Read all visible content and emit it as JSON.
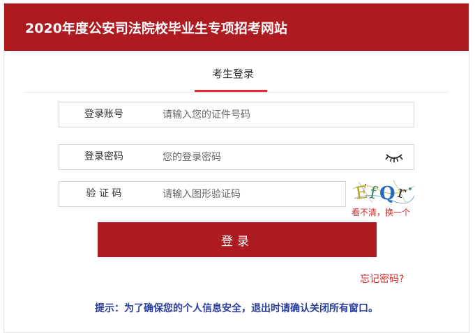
{
  "header": {
    "title": "2020年度公安司法院校毕业生专项招考网站",
    "color": "#ad1a1f"
  },
  "tabs": [
    {
      "label": "考生登录",
      "active": true
    }
  ],
  "form": {
    "account": {
      "label": "登录账号",
      "placeholder": "请输入您的证件号码",
      "value": ""
    },
    "password": {
      "label": "登录密码",
      "placeholder": "您的登录密码",
      "value": "",
      "toggle_icon": "eye-closed-icon"
    },
    "captcha": {
      "label": "验  证  码",
      "placeholder": "请输入图形验证码",
      "value": "",
      "image_text": "EfQr",
      "refresh_label": "看不清，换一个"
    },
    "submit_label": "登录",
    "forgot_label": "忘记密码?"
  },
  "tip": "提示：为了确保您的个人信息安全，退出时请确认关闭所有窗口。"
}
